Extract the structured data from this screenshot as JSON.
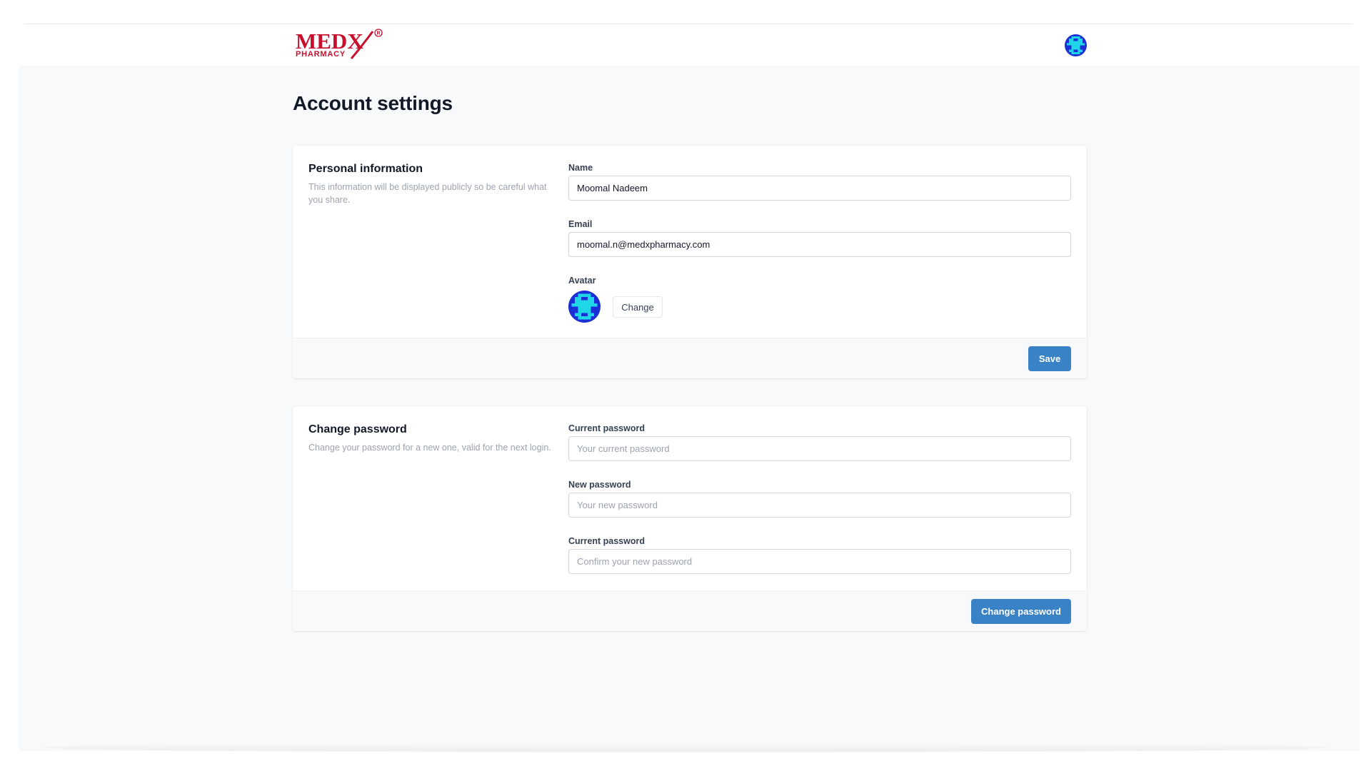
{
  "header": {
    "logo_text": "MEDX",
    "logo_subtext": "PHARMACY",
    "logo_mark": "®"
  },
  "page": {
    "title": "Account settings"
  },
  "personal_info": {
    "title": "Personal information",
    "description": "This information will be displayed publicly so be careful what you share.",
    "name_label": "Name",
    "name_value": "Moomal Nadeem",
    "email_label": "Email",
    "email_value": "moomal.n@medxpharmacy.com",
    "avatar_label": "Avatar",
    "change_label": "Change",
    "save_label": "Save"
  },
  "change_password": {
    "title": "Change password",
    "description": "Change your password for a new one, valid for the next login.",
    "current_label": "Current password",
    "current_placeholder": "Your current password",
    "new_label": "New password",
    "new_placeholder": "Your new password",
    "confirm_label": "Current password",
    "confirm_placeholder": "Confirm your new password",
    "submit_label": "Change password"
  },
  "colors": {
    "brand_red": "#c8102e",
    "primary_button": "#3a82c6",
    "avatar_blue": "#1b2fd6",
    "avatar_cyan": "#1fd6e8"
  },
  "icons": {
    "avatar": "pixel-avatar-icon",
    "logo": "medx-logo"
  }
}
